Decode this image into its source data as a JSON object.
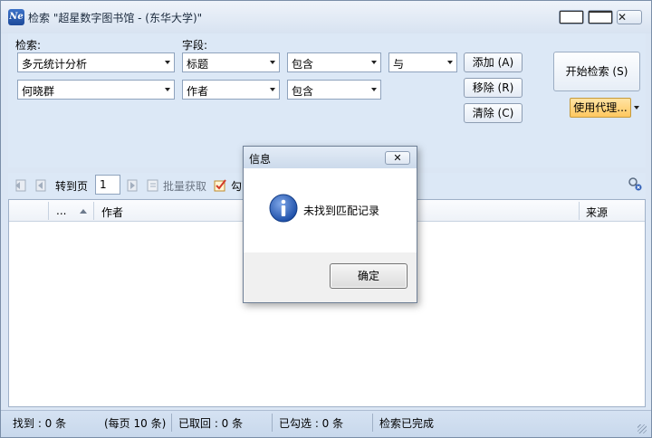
{
  "window": {
    "title": "检索 \"超星数字图书馆 - (东华大学)\"",
    "icon_text": "Ne"
  },
  "search": {
    "label_query": "检索:",
    "label_field": "字段:",
    "row1": {
      "query": "多元统计分析",
      "field": "标题",
      "match": "包含",
      "logic": "与"
    },
    "row2": {
      "query": "何晓群",
      "field": "作者",
      "match": "包含"
    },
    "add_button": "添加 (A)",
    "remove_button": "移除 (R)",
    "clear_button": "清除 (C)",
    "start_button": "开始检索 (S)",
    "proxy_button": "使用代理..."
  },
  "toolbar": {
    "goto_label": "转到页",
    "page_value": "1",
    "batch_label": "批量获取",
    "check_label": "勾"
  },
  "grid": {
    "columns": [
      "...",
      "作者",
      "来源"
    ]
  },
  "status": {
    "found": "找到 : 0 条",
    "per_page": "(每页 10 条)",
    "fetched": "已取回 : 0 条",
    "checked": "已勾选 : 0 条",
    "state": "检索已完成"
  },
  "dialog": {
    "title": "信息",
    "message": "未找到匹配记录",
    "ok_button": "确定",
    "close_glyph": "✕"
  },
  "colors": {
    "info_icon": "#2f5fb7",
    "proxy_button": "#ffc860"
  }
}
